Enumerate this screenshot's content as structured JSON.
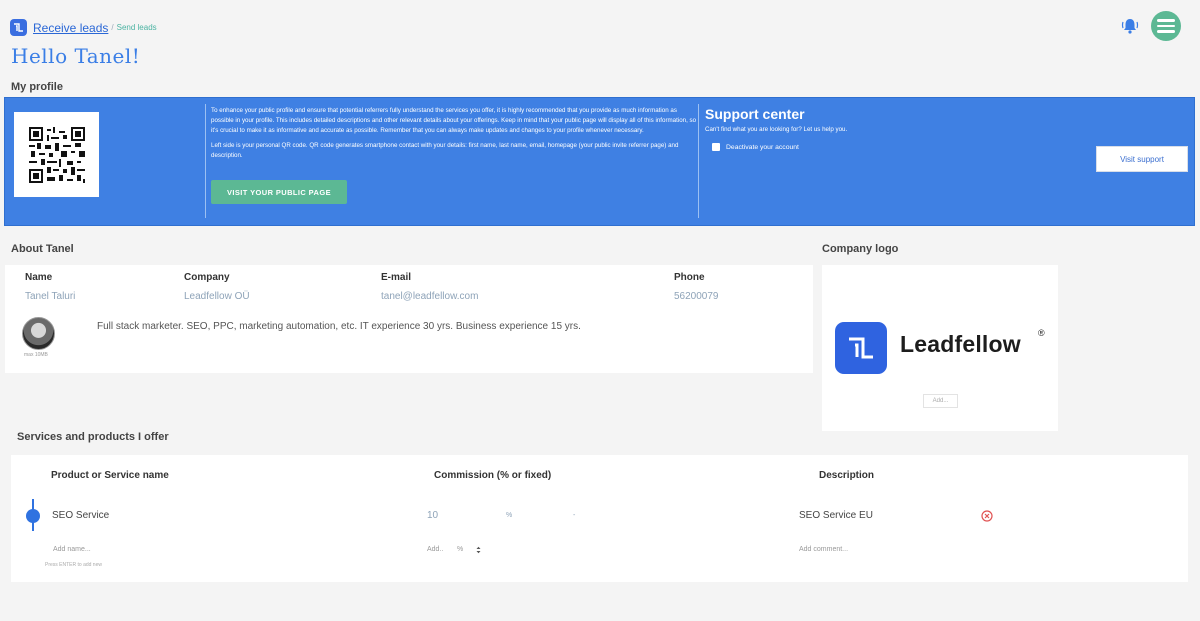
{
  "header": {
    "crumb_main": "Receive leads",
    "crumb_sep": "/",
    "crumb_sub": "Send leads",
    "greeting": "Hello Tanel!"
  },
  "colors": {
    "accent": "#3f80e3",
    "green": "#5cb894",
    "link": "#2a67d6"
  },
  "profile": {
    "title": "My profile",
    "info_p1": "To enhance your public profile and ensure that potential referrers fully understand the services you offer, it is highly recommended that you provide as much information as possible in your profile. This includes detailed descriptions and other relevant details about your offerings. Keep in mind that your public page will display all of this information, so it's crucial to make it as informative and accurate as possible. Remember that you can always make updates and changes to your profile whenever necessary.",
    "info_p2": "Left side is your personal QR code. QR code generates smartphone contact with your details: first name, last name, email, homepage (your public invite referrer page) and description.",
    "visit_public": "VISIT YOUR PUBLIC PAGE",
    "support_title": "Support center",
    "support_sub": "Can't find what you are looking for? Let us help you.",
    "deactivate": "Deactivate your account",
    "visit_support": "Visit support"
  },
  "about": {
    "title": "About Tanel",
    "name_h": "Name",
    "name_v": "Tanel Taluri",
    "company_h": "Company",
    "company_v": "Leadfellow OÜ",
    "email_h": "E-mail",
    "email_v": "tanel@leadfellow.com",
    "phone_h": "Phone",
    "phone_v": "56200079",
    "avatar_caption": "max 10MB",
    "description": "Full stack marketer. SEO, PPC, marketing automation, etc. IT experience 30 yrs. Business experience 15 yrs."
  },
  "company_logo": {
    "title": "Company logo",
    "wordmark": "Leadfellow",
    "reg": "®",
    "add": "Add..."
  },
  "services": {
    "title": "Services and products I offer",
    "col_name": "Product or Service name",
    "col_commission": "Commission (% or fixed)",
    "col_desc": "Description",
    "rows": [
      {
        "name": "SEO Service",
        "commission": "10",
        "unit": "%",
        "dash": "-",
        "description": "SEO Service EU"
      }
    ],
    "add_name": "Add name...",
    "add_commission": "Add..",
    "add_unit": "%",
    "add_comment": "Add comment...",
    "hint": "Press ENTER to add new"
  }
}
